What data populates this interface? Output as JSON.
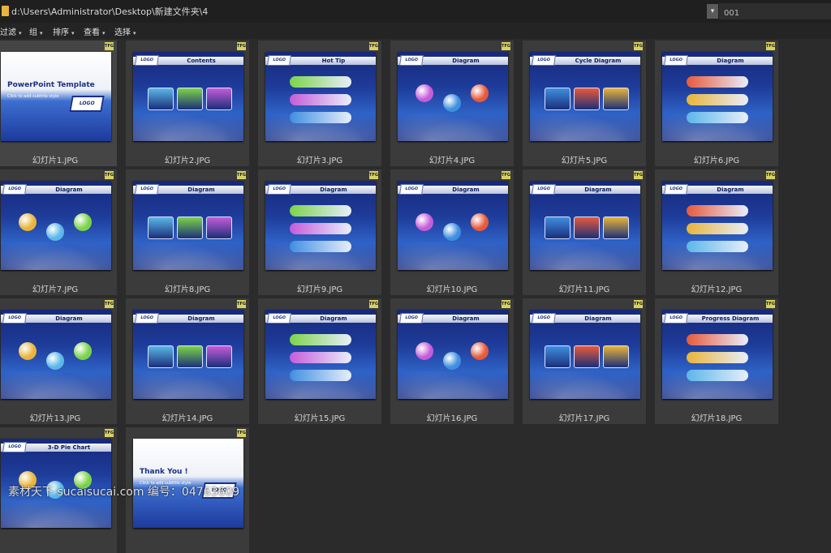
{
  "address_bar": {
    "path": "d:\\Users\\Administrator\\Desktop\\新建文件夹\\4",
    "search_value": "001",
    "dropdown_glyph": "▾"
  },
  "toolbar": {
    "arrow": "▾",
    "items": [
      {
        "label": "过滤"
      },
      {
        "label": "组"
      },
      {
        "label": "排序"
      },
      {
        "label": "查看"
      },
      {
        "label": "选择"
      }
    ]
  },
  "files": [
    {
      "name": "幻灯片1.JPG",
      "thumb_title": "PowerPoint Template",
      "subtitle": "Click to add subtitle style",
      "logo": "LOGO"
    },
    {
      "name": "幻灯片2.JPG",
      "thumb_title": "Contents"
    },
    {
      "name": "幻灯片3.JPG",
      "thumb_title": "Hot Tip"
    },
    {
      "name": "幻灯片4.JPG",
      "thumb_title": "Diagram"
    },
    {
      "name": "幻灯片5.JPG",
      "thumb_title": "Cycle Diagram"
    },
    {
      "name": "幻灯片6.JPG",
      "thumb_title": "Diagram"
    },
    {
      "name": "幻灯片7.JPG",
      "thumb_title": "Diagram"
    },
    {
      "name": "幻灯片8.JPG",
      "thumb_title": "Diagram"
    },
    {
      "name": "幻灯片9.JPG",
      "thumb_title": "Diagram"
    },
    {
      "name": "幻灯片10.JPG",
      "thumb_title": "Diagram"
    },
    {
      "name": "幻灯片11.JPG",
      "thumb_title": "Diagram"
    },
    {
      "name": "幻灯片12.JPG",
      "thumb_title": "Diagram"
    },
    {
      "name": "幻灯片13.JPG",
      "thumb_title": "Diagram"
    },
    {
      "name": "幻灯片14.JPG",
      "thumb_title": "Diagram"
    },
    {
      "name": "幻灯片15.JPG",
      "thumb_title": "Diagram"
    },
    {
      "name": "幻灯片16.JPG",
      "thumb_title": "Diagram"
    },
    {
      "name": "幻灯片17.JPG",
      "thumb_title": "Diagram"
    },
    {
      "name": "幻灯片18.JPG",
      "thumb_title": "Progress Diagram"
    },
    {
      "name": "",
      "thumb_title": "3-D Pie Chart"
    },
    {
      "name": "",
      "thumb_title": "Thank You !",
      "subtitle": "Click to add subtitle style"
    }
  ],
  "badge_text": "TFG",
  "logo_text": "LOGO",
  "watermark": "素材天下 sucaisucai.com  编号：04763609",
  "colors": {
    "background": "#2b2b2b",
    "tile": "#3b3b3b",
    "folder_icon": "#e8b53a"
  }
}
